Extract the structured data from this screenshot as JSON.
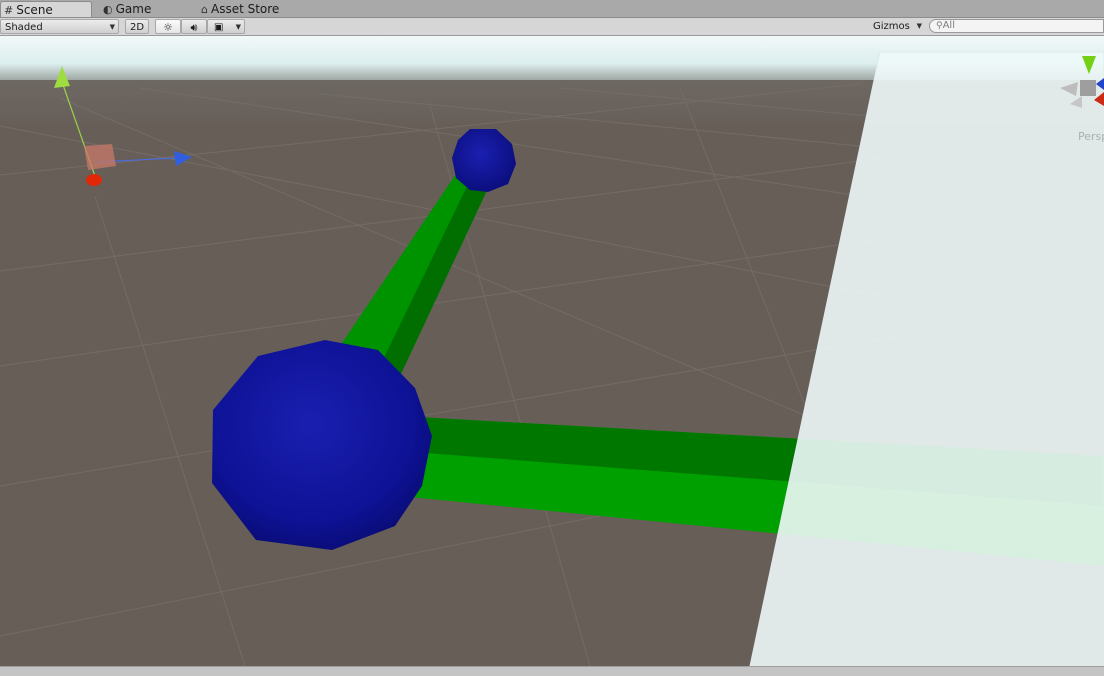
{
  "tabs": [
    {
      "label": "Scene",
      "icon": "scene-grid-icon",
      "active": true
    },
    {
      "label": "Game",
      "icon": "game-pacman-icon",
      "active": false
    },
    {
      "label": "Asset Store",
      "icon": "asset-store-bag-icon",
      "active": false
    }
  ],
  "toolbar": {
    "shading_mode": "Shaded",
    "mode_2d_label": "2D",
    "lighting_icon": "sun-icon",
    "audio_icon": "speaker-icon",
    "effects_icon": "image-icon",
    "gizmos_label": "Gizmos",
    "search_placeholder": "All"
  },
  "scene": {
    "projection_label": "Persp",
    "colors": {
      "ground": "#675e58",
      "sky": "#e8f4f4",
      "sphere": "#0f129c",
      "cylinder": "#00a000",
      "white_plane": "#eef8f8"
    }
  }
}
